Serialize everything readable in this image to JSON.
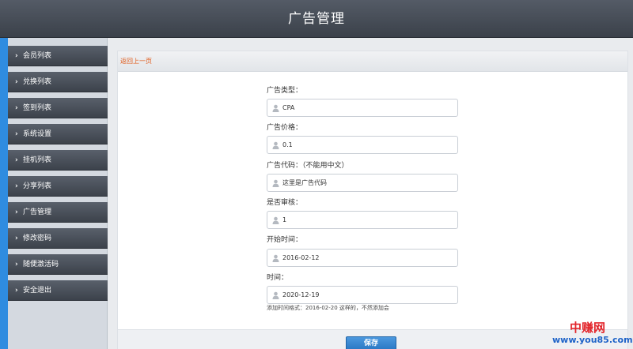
{
  "header": {
    "title": "广告管理"
  },
  "sidebar": {
    "items": [
      {
        "label": "会员列表"
      },
      {
        "label": "兑换列表"
      },
      {
        "label": "签到列表"
      },
      {
        "label": "系统设置"
      },
      {
        "label": "挂机列表"
      },
      {
        "label": "分享列表"
      },
      {
        "label": "广告管理"
      },
      {
        "label": "修改密码"
      },
      {
        "label": "随便激活码"
      },
      {
        "label": "安全退出"
      }
    ]
  },
  "main": {
    "back_link": "返回上一页",
    "fields": [
      {
        "label": "广告类型：",
        "value": "CPA"
      },
      {
        "label": "广告价格：",
        "value": "0.1"
      },
      {
        "label": "广告代码：（不能用中文）",
        "value": "这里是广告代码"
      },
      {
        "label": "是否审核：",
        "value": "1"
      },
      {
        "label": "开始时间：",
        "value": "2016-02-12"
      },
      {
        "label": "时间：",
        "value": "2020-12-19"
      }
    ],
    "hint": "添加时间格式：2016-02-20 这样的，不然添加会",
    "save_label": "保存"
  },
  "watermark": {
    "brand": "中赚网",
    "url": "www.you85.com"
  }
}
